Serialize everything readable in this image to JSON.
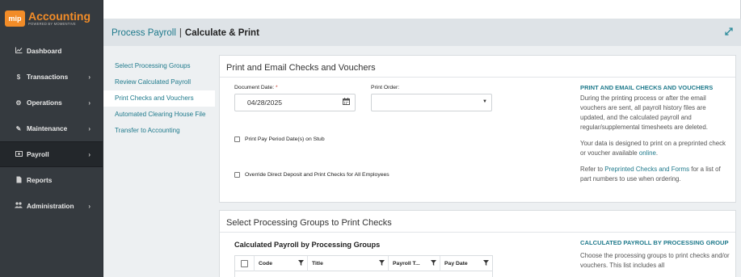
{
  "app": {
    "logo_badge": "mip",
    "logo_title": "Accounting",
    "logo_subtitle": "POWERED BY MOMENTIVE",
    "brand_color": "#f28c28",
    "accent_color": "#1f7a8c"
  },
  "sidebar": {
    "items": [
      {
        "label": "Dashboard",
        "icon": "chart-line-icon",
        "chevron": ""
      },
      {
        "label": "Transactions",
        "icon": "dollar-icon",
        "chevron": "›"
      },
      {
        "label": "Operations",
        "icon": "gears-icon",
        "chevron": "›"
      },
      {
        "label": "Maintenance",
        "icon": "wrench-icon",
        "chevron": "›"
      },
      {
        "label": "Payroll",
        "icon": "money-icon",
        "chevron": "›",
        "active": true
      },
      {
        "label": "Reports",
        "icon": "file-icon",
        "chevron": ""
      },
      {
        "label": "Administration",
        "icon": "users-icon",
        "chevron": "›"
      }
    ]
  },
  "header": {
    "breadcrumb_parent": "Process Payroll",
    "separator": "|",
    "current": "Calculate & Print",
    "expand_icon": "expand-icon"
  },
  "subnav": {
    "items": [
      {
        "label": "Select Processing Groups"
      },
      {
        "label": "Review Calculated Payroll"
      },
      {
        "label": "Print Checks and Vouchers",
        "active": true
      },
      {
        "label": "Automated Clearing House File"
      },
      {
        "label": "Transfer to Accounting"
      }
    ]
  },
  "print_card": {
    "title": "Print and Email Checks and Vouchers",
    "document_date_label": "Document Date:",
    "required_mark": "*",
    "document_date_value": "04/28/2025",
    "print_order_label": "Print Order:",
    "print_order_value": "",
    "checkbox_pay_period": "Print Pay Period Date(s) on Stub",
    "checkbox_override": "Override Direct Deposit and Print Checks for All Employees",
    "help_title": "PRINT AND EMAIL CHECKS AND VOUCHERS",
    "help_p1": "During the printing process or after the email vouchers are sent, all payroll history files are updated, and the calculated payroll and regular/supplemental timesheets are deleted.",
    "help_p2_pre": "Your data is designed to print on a preprinted check or voucher available ",
    "help_p2_link": "online",
    "help_p2_post": ".",
    "help_p3_pre": "Refer to ",
    "help_p3_link": "Preprinted Checks and Forms",
    "help_p3_post": " for a list of part numbers to use when ordering."
  },
  "groups_card": {
    "title": "Select Processing Groups to Print Checks",
    "subtitle": "Calculated Payroll by Processing Groups",
    "columns": [
      "Code",
      "Title",
      "Payroll T...",
      "Pay Date"
    ],
    "help_title": "CALCULATED PAYROLL BY PROCESSING GROUP",
    "help_text": "Choose the processing groups to print checks and/or vouchers. This list includes all"
  }
}
